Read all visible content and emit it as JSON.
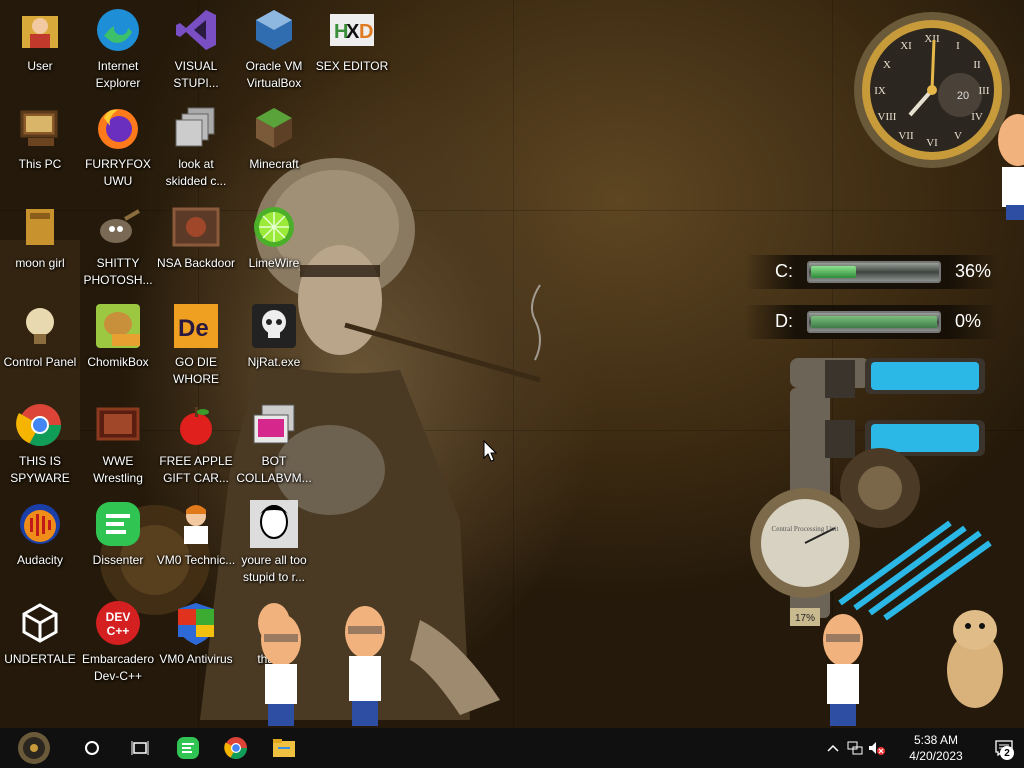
{
  "desktop": {
    "icons": [
      {
        "label": "User",
        "icon": "user-folder-icon"
      },
      {
        "label": "Internet Explorer",
        "icon": "edge-icon"
      },
      {
        "label": "VISUAL STUPI...",
        "icon": "visual-studio-icon"
      },
      {
        "label": "Oracle VM VirtualBox",
        "icon": "virtualbox-icon"
      },
      {
        "label": "SEX EDITOR",
        "icon": "hxd-icon"
      },
      {
        "label": "This PC",
        "icon": "this-pc-icon"
      },
      {
        "label": "FURRYFOX UWU",
        "icon": "firefox-icon"
      },
      {
        "label": "look at skidded c...",
        "icon": "copy-windows-icon"
      },
      {
        "label": "Minecraft",
        "icon": "minecraft-icon"
      },
      {
        "label": "moon girl",
        "icon": "folder-icon"
      },
      {
        "label": "SHITTY PHOTOSH...",
        "icon": "gimp-icon"
      },
      {
        "label": "NSA Backdoor",
        "icon": "nsa-icon"
      },
      {
        "label": "LimeWire",
        "icon": "limewire-icon"
      },
      {
        "label": "Control Panel",
        "icon": "control-panel-icon"
      },
      {
        "label": "ChomikBox",
        "icon": "chomikbox-icon"
      },
      {
        "label": "GO DIE WHORE",
        "icon": "godie-icon"
      },
      {
        "label": "NjRat.exe",
        "icon": "skull-icon"
      },
      {
        "label": "THIS IS SPYWARE",
        "icon": "chrome-icon"
      },
      {
        "label": "WWE Wrestling",
        "icon": "tv-icon"
      },
      {
        "label": "FREE APPLE GIFT CAR...",
        "icon": "apple-icon"
      },
      {
        "label": "BOT COLLABVM...",
        "icon": "screens-icon"
      },
      {
        "label": "Audacity",
        "icon": "audacity-icon"
      },
      {
        "label": "Dissenter",
        "icon": "dissenter-icon"
      },
      {
        "label": "VM0 Technic...",
        "icon": "technician-icon"
      },
      {
        "label": "youre all too stupid to r...",
        "icon": "portrait-icon"
      },
      {
        "label": "UNDERTALE",
        "icon": "unity-icon"
      },
      {
        "label": "Embarcadero Dev-C++",
        "icon": "devcpp-icon"
      },
      {
        "label": "VM0 Antivirus",
        "icon": "shield-icon"
      },
      {
        "label": "tha...2",
        "icon": "hank-icon"
      }
    ]
  },
  "widgets": {
    "disks": [
      {
        "letter": "C:",
        "percent_text": "36%",
        "fill": 0.36
      },
      {
        "letter": "D:",
        "percent_text": "0%",
        "fill": 0.0
      }
    ],
    "clock": {
      "numerals": [
        "XII",
        "I",
        "II",
        "III",
        "IV",
        "V",
        "VI",
        "VII",
        "VIII",
        "IX",
        "X",
        "XI"
      ],
      "date_dial": "20"
    },
    "gauge": {
      "title": "Central Processing Unit",
      "reading": "17%"
    }
  },
  "taskbar": {
    "clock_time": "5:38 AM",
    "clock_date": "4/20/2023",
    "notification_count": "2",
    "pinned": [
      "cortana-icon",
      "task-view-icon",
      "dissenter-icon",
      "chrome-icon",
      "file-explorer-icon"
    ]
  },
  "colors": {
    "taskbar_bg": "#101010",
    "disk_fill": "#3fa84a",
    "pipe_blue": "#2bb8e6"
  }
}
